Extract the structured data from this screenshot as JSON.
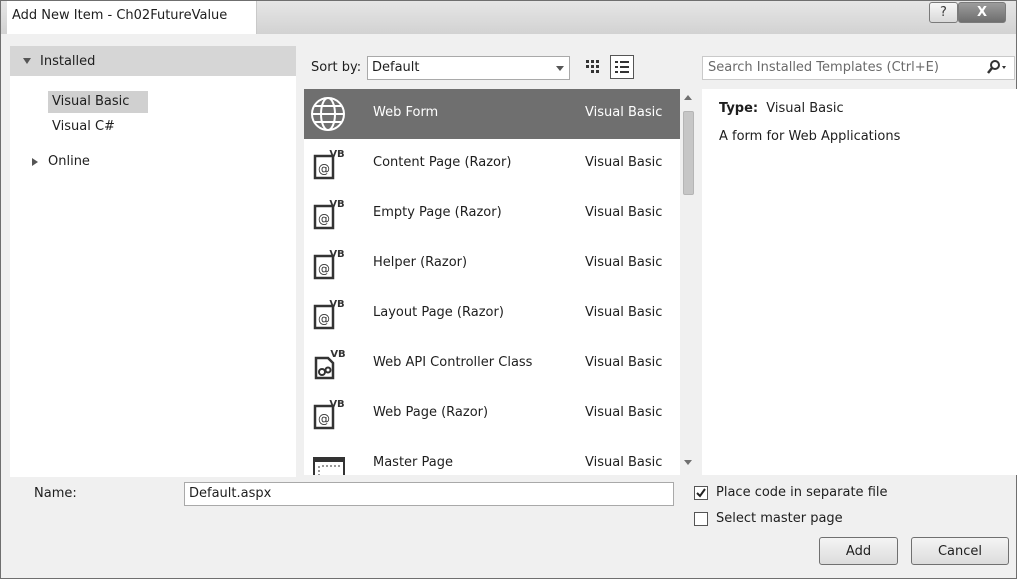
{
  "window": {
    "title": "Add New Item - Ch02FutureValue",
    "help_glyph": "?",
    "close_glyph": "X"
  },
  "left_pane": {
    "installed_label": "Installed",
    "items": [
      {
        "label": "Visual Basic",
        "selected": true
      },
      {
        "label": "Visual C#",
        "selected": false
      }
    ],
    "online_label": "Online"
  },
  "toolbar": {
    "sort_by_label": "Sort by:",
    "sort_value": "Default"
  },
  "templates": [
    {
      "name": "Web Form",
      "lang": "Visual Basic",
      "icon": "globe-icon",
      "selected": true
    },
    {
      "name": "Content Page (Razor)",
      "lang": "Visual Basic",
      "icon": "vb-razor-icon",
      "selected": false
    },
    {
      "name": "Empty Page (Razor)",
      "lang": "Visual Basic",
      "icon": "vb-razor-icon",
      "selected": false
    },
    {
      "name": "Helper (Razor)",
      "lang": "Visual Basic",
      "icon": "vb-razor-icon",
      "selected": false
    },
    {
      "name": "Layout Page (Razor)",
      "lang": "Visual Basic",
      "icon": "vb-razor-icon",
      "selected": false
    },
    {
      "name": "Web API Controller Class",
      "lang": "Visual Basic",
      "icon": "vb-controller-icon",
      "selected": false
    },
    {
      "name": "Web Page (Razor)",
      "lang": "Visual Basic",
      "icon": "vb-razor-icon",
      "selected": false
    },
    {
      "name": "Master Page",
      "lang": "Visual Basic",
      "icon": "master-page-icon",
      "selected": false
    }
  ],
  "search": {
    "placeholder": "Search Installed Templates (Ctrl+E)"
  },
  "details": {
    "type_label": "Type:",
    "type_value": "Visual Basic",
    "description": "A form for Web Applications"
  },
  "bottom": {
    "name_label": "Name:",
    "name_value": "Default.aspx",
    "place_code_label": "Place code in separate file",
    "place_code_checked": true,
    "master_page_label": "Select master page",
    "master_page_checked": false,
    "add_label": "Add",
    "cancel_label": "Cancel"
  },
  "colors": {
    "selected_row": "#6f6f6f",
    "selected_tree": "#d0d0d0",
    "header_bg": "#d6d6d6"
  }
}
